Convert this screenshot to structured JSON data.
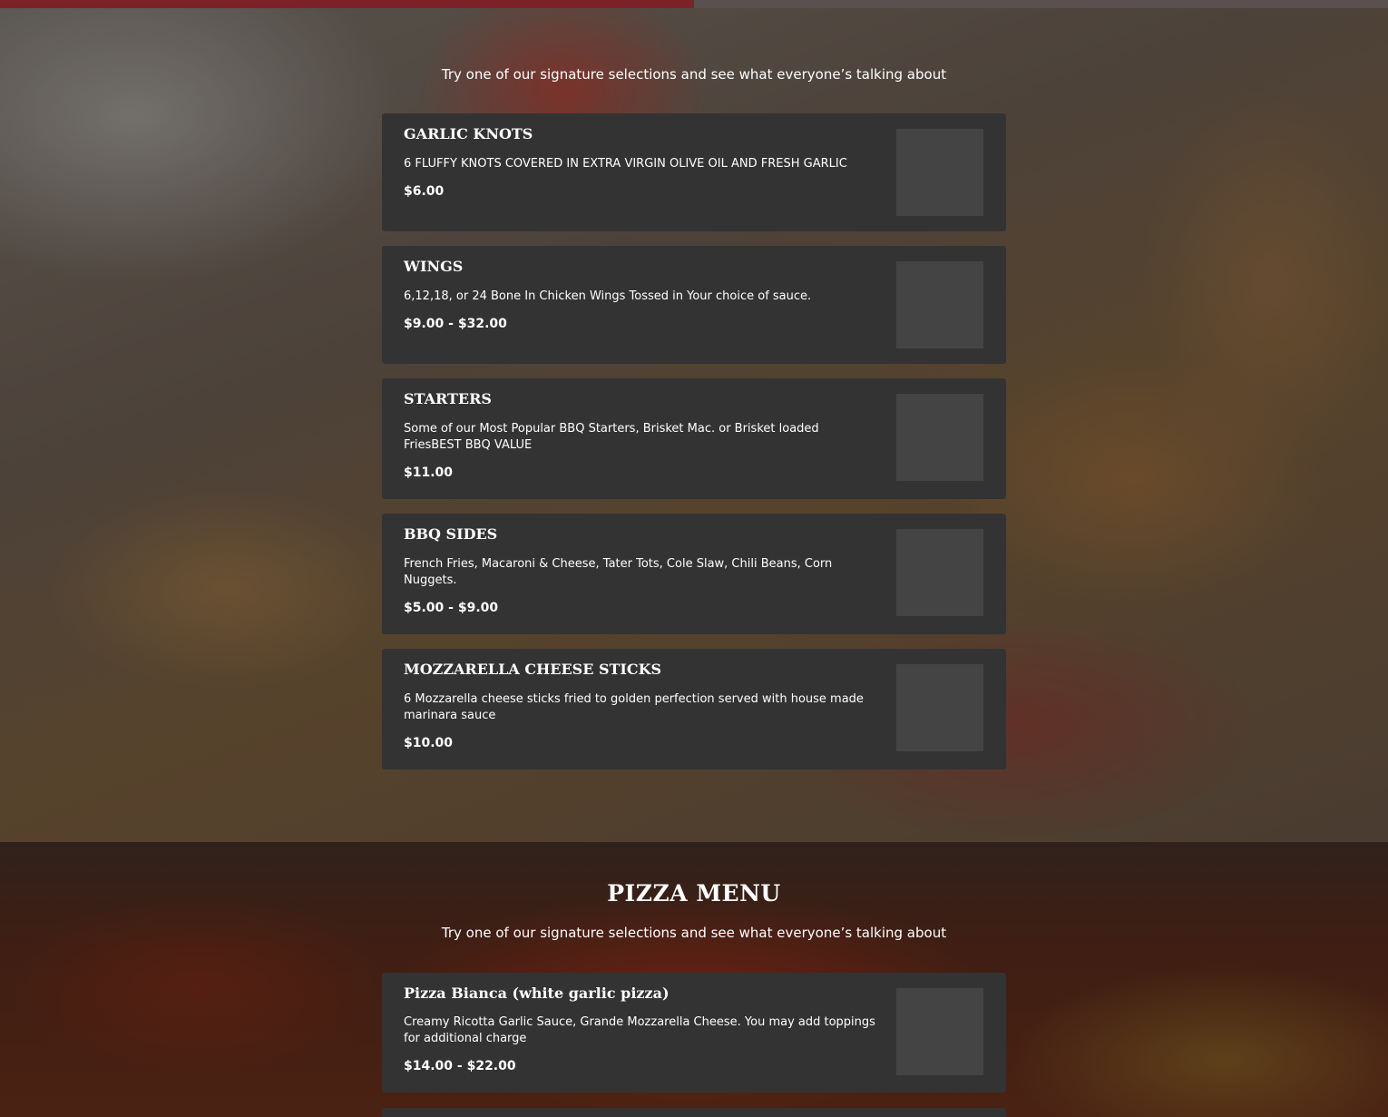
{
  "scroll_progress": 0.5,
  "appetizers": {
    "subtitle": "Try one of our signature selections and see what everyone’s talking about",
    "items": [
      {
        "name": "GARLIC KNOTS",
        "description": "6 FLUFFY KNOTS COVERED IN EXTRA VIRGIN OLIVE OIL AND FRESH GARLIC",
        "price": "$6.00"
      },
      {
        "name": "WINGS",
        "description": "6,12,18, or 24 Bone In Chicken Wings Tossed in Your choice of sauce.",
        "price": "$9.00 - $32.00"
      },
      {
        "name": "STARTERS",
        "description": "Some of our Most Popular BBQ Starters, Brisket Mac. or Brisket loaded FriesBEST BBQ VALUE",
        "price": "$11.00"
      },
      {
        "name": "BBQ SIDES",
        "description": "French Fries, Macaroni & Cheese, Tater Tots, Cole Slaw, Chili Beans, Corn Nuggets.",
        "price": "$5.00 - $9.00"
      },
      {
        "name": "MOZZARELLA CHEESE STICKS",
        "description": "6 Mozzarella cheese sticks fried to golden perfection served with house made marinara sauce",
        "price": "$10.00"
      }
    ]
  },
  "pizza": {
    "title": "PIZZA MENU",
    "subtitle": "Try one of our signature selections and see what everyone’s talking about",
    "items": [
      {
        "name": "Pizza Bianca (white garlic pizza)",
        "description": "Creamy Ricotta Garlic Sauce, Grande Mozzarella Cheese. You may add toppings for additional charge",
        "price": "$14.00 - $22.00"
      }
    ]
  }
}
